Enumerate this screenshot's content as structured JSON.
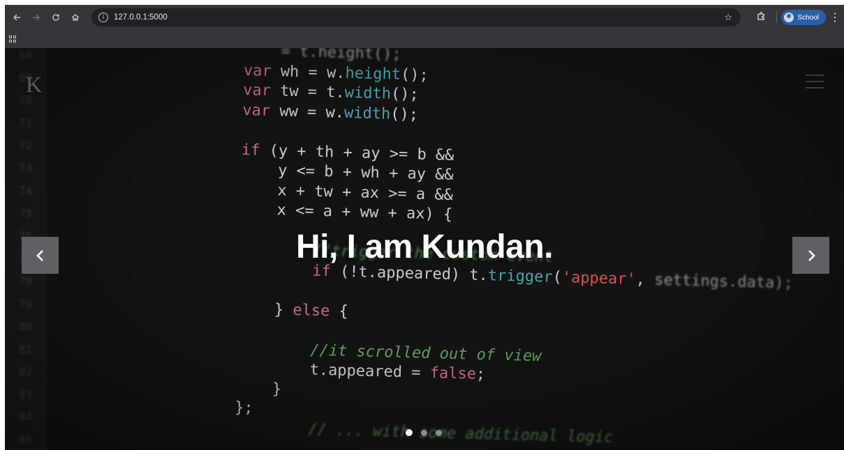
{
  "browser": {
    "url": "127.0.0.1:5000",
    "profile_label": "School",
    "icons": {
      "back": "arrow-left-icon",
      "forward": "arrow-right-icon",
      "reload": "reload-icon",
      "home": "home-icon",
      "site_info": "info-icon",
      "bookmark": "star-icon",
      "extensions": "puzzle-icon",
      "menu": "kebab-icon",
      "apps": "apps-grid-icon"
    }
  },
  "site": {
    "logo_letter": "K",
    "hero_title": "Hi, I am Kundan.",
    "carousel": {
      "prev_icon": "chevron-left-icon",
      "next_icon": "chevron-right-icon",
      "slide_count": 3,
      "active_slide": 1
    }
  },
  "background_code": {
    "gutter_numbers": [
      "68",
      "69",
      "70",
      "71",
      "72",
      "73",
      "74",
      "75",
      "76",
      "77",
      "78",
      "79",
      "80",
      "81",
      "82",
      "83",
      "84",
      "85"
    ]
  }
}
